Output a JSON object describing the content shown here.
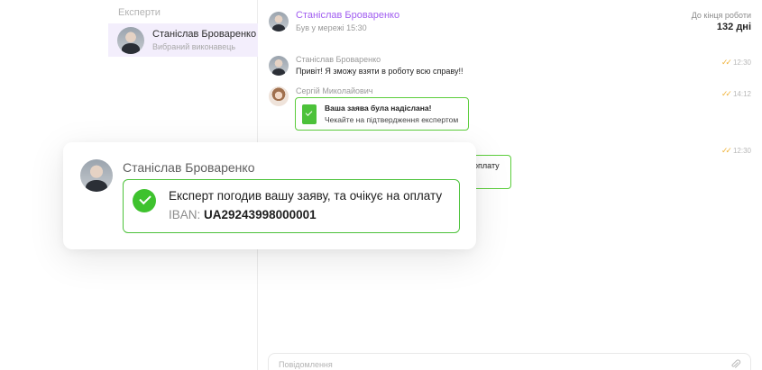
{
  "sidebar": {
    "heading": "Експерти",
    "expert": {
      "name": "Станіслав Броваренко",
      "role": "Вибраний виконавець",
      "avatar_icon": "man-portrait-avatar"
    }
  },
  "chat_header": {
    "name": "Станіслав Броваренко",
    "status": "Був у мережі 15:30",
    "deadline_label": "До кінця роботи",
    "deadline_value": "132 дні"
  },
  "messages": [
    {
      "author": "Станіслав Броваренко",
      "text": "Привіт! Я зможу взяти в роботу всю справу!!",
      "time": "12:30"
    },
    {
      "author": "Сергій Миколайович",
      "notice_title": "Ваша заява була надіслана!",
      "notice_sub": "Чекайте на підтвердження експертом",
      "time": "14:12"
    },
    {
      "time": "12:30",
      "partial_text": "оплату"
    }
  ],
  "input": {
    "placeholder": "Повідомлення"
  },
  "popup": {
    "name": "Станіслав Броваренко",
    "title": "Експерт погодив вашу заяву, та очікує на оплату",
    "iban_label": "IBAN:",
    "iban_value": "UA29243998000001"
  },
  "colors": {
    "accent": "#a15ef0",
    "success": "#4cc23a",
    "tick": "#f0b33a"
  }
}
